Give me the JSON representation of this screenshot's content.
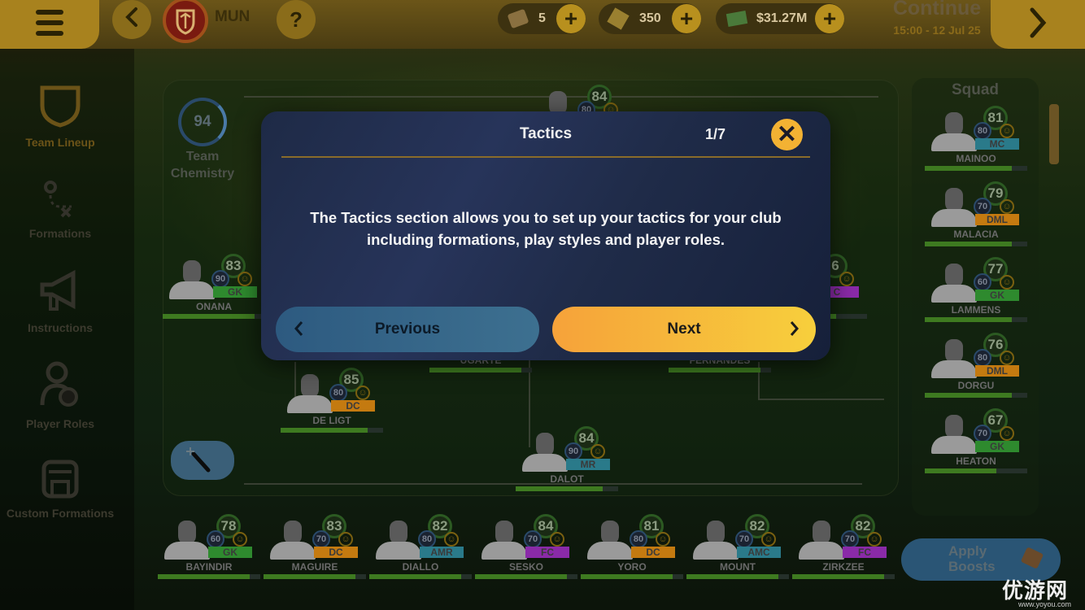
{
  "header": {
    "club_abbr": "MUN",
    "help_label": "?",
    "resources": [
      {
        "icon": "tokens-icon",
        "value": "5"
      },
      {
        "icon": "cards-icon",
        "value": "350"
      },
      {
        "icon": "money-icon",
        "value": "$31.27M"
      }
    ],
    "continue_label": "Continue",
    "continue_date": "15:00 - 12 Jul 25"
  },
  "sidebar": {
    "items": [
      {
        "label": "Team Lineup",
        "icon": "shield-icon",
        "active": true
      },
      {
        "label": "Formations",
        "icon": "formations-icon"
      },
      {
        "label": "Instructions",
        "icon": "megaphone-icon"
      },
      {
        "label": "Player Roles",
        "icon": "player-roles-icon"
      },
      {
        "label": "Custom Formations",
        "icon": "save-icon"
      }
    ]
  },
  "chemistry": {
    "value": "94",
    "label_line1": "Team",
    "label_line2": "Chemistry"
  },
  "pitch_players": [
    {
      "name": "",
      "ovr": "84",
      "pot": "80",
      "pos": "",
      "pos_color": "#2a7a8a",
      "bar": 0.8
    },
    {
      "name": "ONANA",
      "ovr": "83",
      "pot": "90",
      "pos": "GK",
      "pos_color": "#2e8a2e",
      "bar": 0.9
    },
    {
      "name": "",
      "ovr": "6",
      "pot": "",
      "pos": "C",
      "pos_color": "#8a2aa8",
      "bar": 0.7
    },
    {
      "name": "UGARTE",
      "ovr": "",
      "pot": "",
      "pos": "",
      "pos_color": "",
      "bar": 0.9
    },
    {
      "name": "FERNANDES",
      "ovr": "",
      "pot": "",
      "pos": "",
      "pos_color": "",
      "bar": 0.9
    },
    {
      "name": "DE LIGT",
      "ovr": "85",
      "pot": "80",
      "pos": "DC",
      "pos_color": "#c47a10",
      "bar": 0.85
    },
    {
      "name": "DALOT",
      "ovr": "84",
      "pot": "90",
      "pos": "MR",
      "pos_color": "#2a7a8a",
      "bar": 0.85
    }
  ],
  "bench": [
    {
      "name": "BAYINDIR",
      "ovr": "78",
      "pot": "60",
      "pos": "GK",
      "pos_color": "#2e8a2e",
      "bar": 0.9
    },
    {
      "name": "MAGUIRE",
      "ovr": "83",
      "pot": "70",
      "pos": "DC",
      "pos_color": "#c47a10",
      "bar": 0.9
    },
    {
      "name": "DIALLO",
      "ovr": "82",
      "pot": "80",
      "pos": "AMR",
      "pos_color": "#2a7a8a",
      "bar": 0.9
    },
    {
      "name": "SESKO",
      "ovr": "84",
      "pot": "70",
      "pos": "FC",
      "pos_color": "#8a2aa8",
      "bar": 0.9
    },
    {
      "name": "YORO",
      "ovr": "81",
      "pot": "80",
      "pos": "DC",
      "pos_color": "#c47a10",
      "bar": 0.9
    },
    {
      "name": "MOUNT",
      "ovr": "82",
      "pot": "70",
      "pos": "AMC",
      "pos_color": "#2a7a8a",
      "bar": 0.9
    },
    {
      "name": "ZIRKZEE",
      "ovr": "82",
      "pot": "70",
      "pos": "FC",
      "pos_color": "#8a2aa8",
      "bar": 0.9
    }
  ],
  "squad": {
    "title": "Squad",
    "players": [
      {
        "name": "MAINOO",
        "ovr": "81",
        "pot": "80",
        "pos": "MC",
        "pos_color": "#2a7a8a",
        "bar": 0.85
      },
      {
        "name": "MALACIA",
        "ovr": "79",
        "pot": "70",
        "pos": "DML",
        "pos_color": "#c47a10",
        "bar": 0.85
      },
      {
        "name": "LAMMENS",
        "ovr": "77",
        "pot": "60",
        "pos": "GK",
        "pos_color": "#2e8a2e",
        "bar": 0.85
      },
      {
        "name": "DORGU",
        "ovr": "76",
        "pot": "80",
        "pos": "DML",
        "pos_color": "#c47a10",
        "bar": 0.85
      },
      {
        "name": "HEATON",
        "ovr": "67",
        "pot": "70",
        "pos": "GK",
        "pos_color": "#2e8a2e",
        "bar": 0.7
      }
    ]
  },
  "apply_boosts": {
    "line1": "Apply",
    "line2": "Boosts"
  },
  "modal": {
    "title": "Tactics",
    "page": "1/7",
    "message": "The Tactics section allows you to set up your tactics for your club including formations, play styles and player roles.",
    "previous_label": "Previous",
    "next_label": "Next"
  },
  "watermark": {
    "text": "优游网",
    "url_text": "www.yoyou.com"
  }
}
